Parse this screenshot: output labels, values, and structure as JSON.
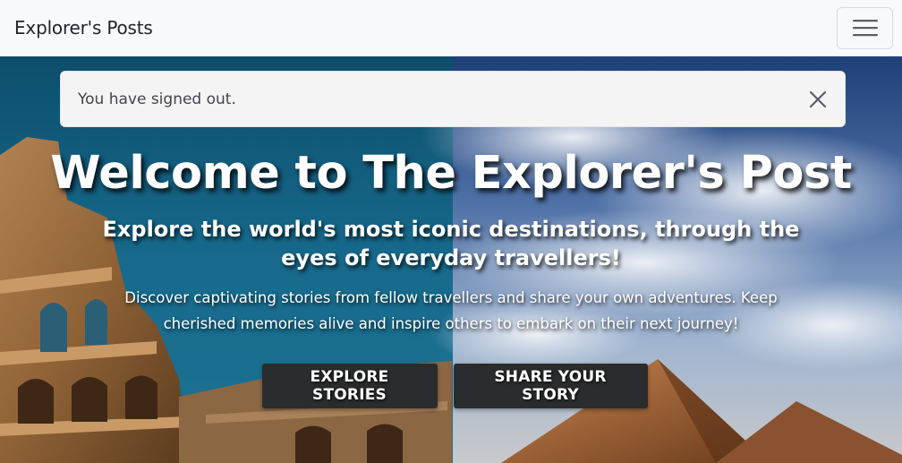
{
  "navbar": {
    "brand": "Explorer's Posts",
    "toggler_icon": "hamburger-icon"
  },
  "alert": {
    "message": "You have signed out.",
    "close_icon": "close-icon"
  },
  "hero": {
    "title": "Welcome to The Explorer's Post",
    "subtitle": "Explore the world's most iconic destinations, through the eyes of everyday travellers!",
    "description": "Discover captivating stories from fellow travellers and share your own adventures. Keep cherished memories alive and inspire others to embark on their next journey!",
    "buttons": {
      "explore": "EXPLORE STORIES",
      "share": "SHARE YOUR STORY"
    }
  },
  "colors": {
    "navbar_bg": "#f8f9fa",
    "alert_bg": "#f4f4f5",
    "button_bg": "#2b2c2d",
    "hero_text": "#ffffff"
  }
}
